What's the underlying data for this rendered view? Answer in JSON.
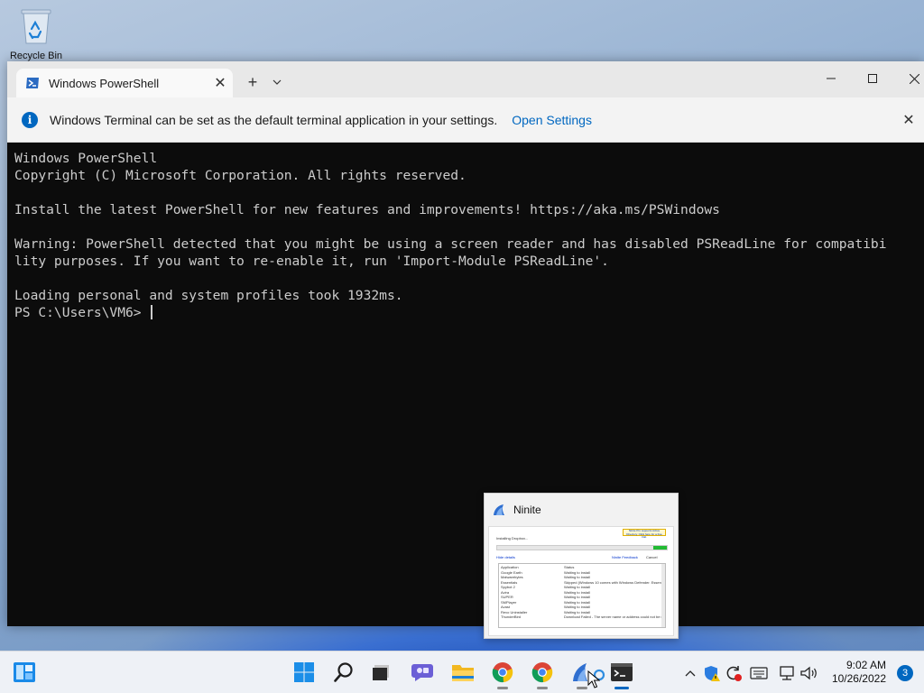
{
  "desktop": {
    "recycle_bin_label": "Recycle Bin"
  },
  "terminal": {
    "tab_title": "Windows PowerShell",
    "new_tab_symbol": "+",
    "infobar": {
      "message": "Windows Terminal can be set as the default terminal application in your settings.",
      "link": "Open Settings"
    },
    "lines": [
      "Windows PowerShell",
      "Copyright (C) Microsoft Corporation. All rights reserved.",
      "",
      "Install the latest PowerShell for new features and improvements! https://aka.ms/PSWindows",
      "",
      "Warning: PowerShell detected that you might be using a screen reader and has disabled PSReadLine for compatibi",
      "lity purposes. If you want to re-enable it, run 'Import-Module PSReadLine'.",
      "",
      "Loading personal and system profiles took 1932ms."
    ],
    "prompt": "PS C:\\Users\\VM6> "
  },
  "ninite_preview": {
    "title": "Ninite",
    "banner": "Ninite Pro supports Active Directory. Click here for a free trial.",
    "status": "Installing Dropbox...",
    "progress_fraction": 0.08,
    "hide_details": "Hide details",
    "feedback": "Ninite Feedback",
    "cancel": "Cancel",
    "table": {
      "headers": [
        "Application",
        "Status"
      ],
      "rows": [
        [
          "Google Earth",
          "Waiting to install"
        ],
        [
          "Malwarebytes",
          "Waiting to install"
        ],
        [
          "Essentials",
          "Skipped (Windows 10 comes with Windows Defender. Essentials...)"
        ],
        [
          "Spybot 2",
          "Waiting to install"
        ],
        [
          "Avira",
          "Waiting to install"
        ],
        [
          "SUPER",
          "Waiting to install"
        ],
        [
          "SMPlayer",
          "Waiting to install"
        ],
        [
          "Avast",
          "Waiting to install"
        ],
        [
          "Revo Uninstaller",
          "Waiting to install"
        ],
        [
          "ThunderBird",
          "Download Failed - The server name or address could not be re..."
        ]
      ]
    }
  },
  "taskbar": {
    "pinned": [
      {
        "name": "start",
        "active": false
      },
      {
        "name": "search",
        "active": false
      },
      {
        "name": "task-view",
        "active": false
      },
      {
        "name": "chat",
        "active": false
      },
      {
        "name": "file-explorer",
        "active": false
      },
      {
        "name": "chrome",
        "active": false
      },
      {
        "name": "chrome-2",
        "active": false
      },
      {
        "name": "ninite",
        "active": false
      },
      {
        "name": "terminal",
        "active": true
      }
    ],
    "clock_time": "9:02 AM",
    "clock_date": "10/26/2022",
    "notification_count": "3"
  },
  "colors": {
    "accent": "#0067c0",
    "terminal_bg": "#0c0c0c",
    "terminal_fg": "#cccccc",
    "progress": "#22bb33"
  }
}
